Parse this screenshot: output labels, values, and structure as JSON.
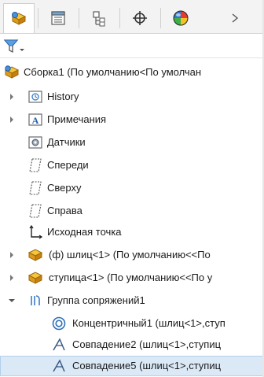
{
  "tabs": [
    {
      "name": "feature-manager",
      "icon": "assembly-tree-icon"
    },
    {
      "name": "property-manager",
      "icon": "property-manager-icon"
    },
    {
      "name": "configuration-manager",
      "icon": "configuration-manager-icon"
    },
    {
      "name": "dimxpert-manager",
      "icon": "crosshair-icon"
    },
    {
      "name": "display-manager",
      "icon": "color-sphere-icon"
    }
  ],
  "tab_overflow_icon": "chevron-right-icon",
  "filter": {
    "icon": "filter-icon"
  },
  "tree": {
    "root": "Сборка1  (По умолчанию<По умолчан",
    "history": "History",
    "annotations": "Примечания",
    "sensors": "Датчики",
    "plane_front": "Спереди",
    "plane_top": "Сверху",
    "plane_right": "Справа",
    "origin": "Исходная точка",
    "part1": "(ф) шлиц<1> (По умолчанию<<По",
    "part2": "ступица<1> (По умолчанию<<По у",
    "mates_group": "Группа сопряжений1",
    "mate1": "Концентричный1 (шлиц<1>,ступ",
    "mate2": "Совпадение2 (шлиц<1>,ступиц",
    "mate3": "Совпадение5 (шлиц<1>,ступиц"
  },
  "colors": {
    "selection": "#dbe9f7",
    "accent": "#1e6fc9",
    "part_yellow": "#e8b023"
  }
}
